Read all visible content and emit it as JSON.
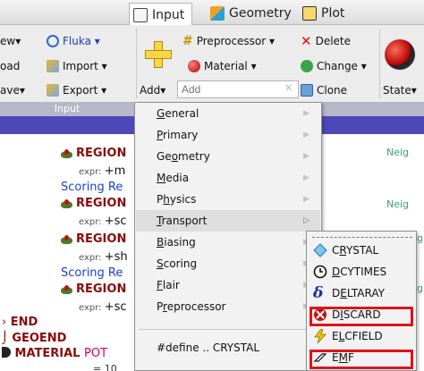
{
  "tabs": [
    {
      "label": "Input",
      "icon": "input-icon",
      "active": true
    },
    {
      "label": "Geometry",
      "icon": "geometry-icon",
      "active": false
    },
    {
      "label": "Plot",
      "icon": "plot-icon",
      "active": false
    }
  ],
  "ribbon": {
    "col1": [
      "ew▾",
      "oad",
      "ave▾"
    ],
    "fluka": "Fluka ▾",
    "import": "Import ▾",
    "export": "Export ▾",
    "add": "Add▾",
    "add_placeholder": "Add",
    "preprocessor": "Preprocessor ▾",
    "material": "Material ▾",
    "delete": "Delete",
    "change": "Change ▾",
    "clone": "Clone",
    "state": "State▾",
    "section_title": "Input"
  },
  "tree": {
    "regions": [
      {
        "name": "REGION",
        "expr": "+m"
      },
      {
        "name": "REGION",
        "expr": "+sc"
      },
      {
        "name": "REGION",
        "expr": "+sh"
      },
      {
        "name": "REGION",
        "expr": "+sc"
      }
    ],
    "expr_label": "expr:",
    "scoring": "Scoring Re",
    "neig": "Neig",
    "end": "END",
    "geoend": "GEOEND",
    "material": "MATERIAL",
    "pot": "POT",
    "partial_value": "= 10"
  },
  "menu": {
    "items": [
      {
        "label": "General",
        "ul": "G",
        "rest": "eneral"
      },
      {
        "label": "Primary",
        "ul": "P",
        "rest": "rimary"
      },
      {
        "label": "Geometry",
        "ul": "",
        "pre": "Ge",
        "mid": "o",
        "post": "metry"
      },
      {
        "label": "Media",
        "ul": "M",
        "rest": "edia"
      },
      {
        "label": "Physics",
        "pre": "P",
        "mid": "h",
        "post": "ysics"
      },
      {
        "label": "Transport",
        "ul": "T",
        "rest": "ransport"
      },
      {
        "label": "Biasing",
        "ul": "B",
        "rest": "iasing"
      },
      {
        "label": "Scoring",
        "ul": "S",
        "rest": "coring"
      },
      {
        "label": "Flair",
        "ul": "F",
        "rest": "lair"
      },
      {
        "label": "Preprocessor",
        "pre": "P",
        "mid": "r",
        "post": "eprocessor"
      }
    ],
    "define": "#define .. CRYSTAL"
  },
  "submenu": {
    "items": [
      {
        "label": "CRYSTAL",
        "pre": "C",
        "mid": "R",
        "post": "YSTAL"
      },
      {
        "label": "DCYTIMES",
        "pre": "",
        "mid": "D",
        "post": "CYTIMES"
      },
      {
        "label": "DELTARAY",
        "pre": "D",
        "mid": "E",
        "post": "LTARAY"
      },
      {
        "label": "DISCARD",
        "pre": "D",
        "mid": "I",
        "post": "SCARD"
      },
      {
        "label": "ELCFIELD",
        "pre": "E",
        "mid": "L",
        "post": "CFIELD"
      },
      {
        "label": "EMF",
        "pre": "E",
        "mid": "M",
        "post": "F"
      }
    ]
  }
}
